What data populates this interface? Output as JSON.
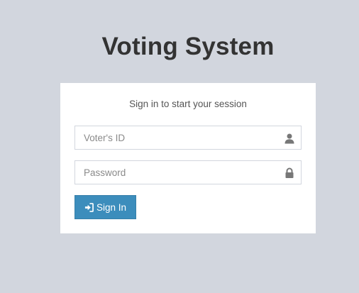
{
  "login": {
    "title": "Voting System",
    "message": "Sign in to start your session",
    "voter_id": {
      "placeholder": "Voter's ID",
      "value": "",
      "icon": "user-icon"
    },
    "password": {
      "placeholder": "Password",
      "value": "",
      "icon": "lock-icon"
    },
    "sign_in_button": {
      "label": "Sign In",
      "icon": "sign-in-icon"
    }
  },
  "colors": {
    "background": "#d2d6de",
    "card": "#ffffff",
    "primary": "#3c8dbc",
    "text": "#333333"
  }
}
